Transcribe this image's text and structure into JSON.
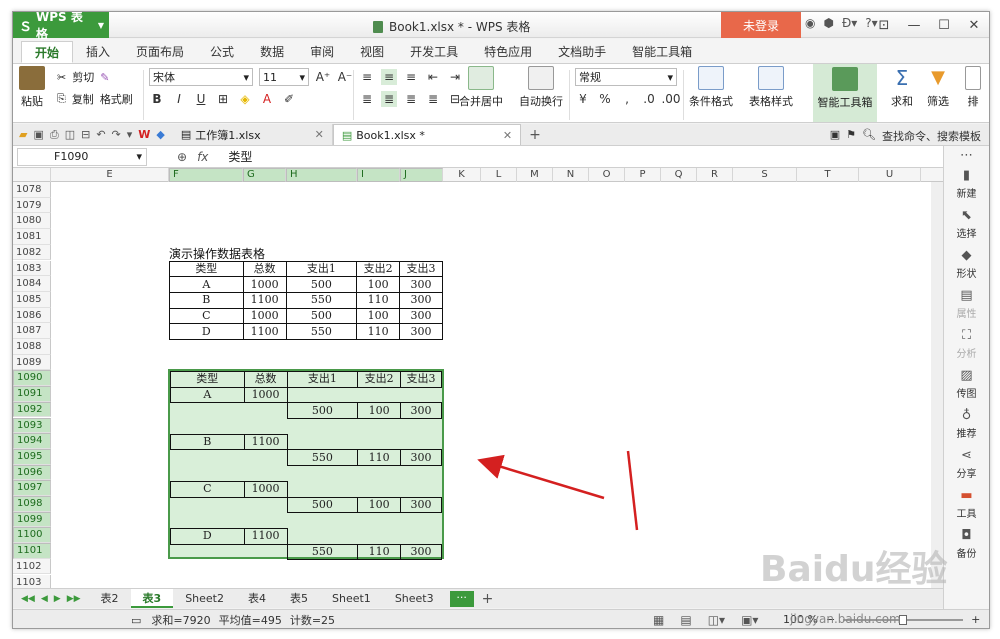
{
  "app": {
    "brand": "WPS 表格",
    "doc_title": "Book1.xlsx * - WPS 表格",
    "login": "未登录"
  },
  "menu": [
    "开始",
    "插入",
    "页面布局",
    "公式",
    "数据",
    "审阅",
    "视图",
    "开发工具",
    "特色应用",
    "文档助手",
    "智能工具箱"
  ],
  "ribbon": {
    "paste": "粘贴",
    "cut": "剪切",
    "copy": "复制",
    "format_painter": "格式刷",
    "font_name": "宋体",
    "font_size": "11",
    "merge_center": "合并居中",
    "wrap": "自动换行",
    "number_format": "常规",
    "cond_format": "条件格式",
    "table_style": "表格样式",
    "smart_toolbox": "智能工具箱",
    "sum": "求和",
    "filter": "筛选",
    "sort": "排"
  },
  "doctabs": {
    "tab1": "工作簿1.xlsx",
    "tab2": "Book1.xlsx *",
    "find": "查找命令、搜索模板"
  },
  "formula": {
    "namebox": "F1090",
    "content": "类型"
  },
  "columns": [
    "E",
    "F",
    "G",
    "H",
    "I",
    "J",
    "K",
    "L",
    "M",
    "N",
    "O",
    "P",
    "Q",
    "R",
    "S",
    "T",
    "U"
  ],
  "rows": [
    "1078",
    "1079",
    "1080",
    "1081",
    "1082",
    "1083",
    "1084",
    "1085",
    "1086",
    "1087",
    "1088",
    "1089",
    "1090",
    "1091",
    "1092",
    "1093",
    "1094",
    "1095",
    "1096",
    "1097",
    "1098",
    "1099",
    "1100",
    "1101",
    "1102",
    "1103"
  ],
  "table1": {
    "caption": "演示操作数据表格",
    "header": [
      "类型",
      "总数",
      "支出1",
      "支出2",
      "支出3"
    ],
    "rows": [
      [
        "A",
        "1000",
        "500",
        "100",
        "300"
      ],
      [
        "B",
        "1100",
        "550",
        "110",
        "300"
      ],
      [
        "C",
        "1000",
        "500",
        "100",
        "300"
      ],
      [
        "D",
        "1100",
        "550",
        "110",
        "300"
      ]
    ]
  },
  "table2": {
    "header": [
      "类型",
      "总数",
      "支出1",
      "支出2",
      "支出3"
    ],
    "groups": [
      {
        "type": "A",
        "total": "1000",
        "vals": [
          "500",
          "100",
          "300"
        ]
      },
      {
        "type": "B",
        "total": "1100",
        "vals": [
          "550",
          "110",
          "300"
        ]
      },
      {
        "type": "C",
        "total": "1000",
        "vals": [
          "500",
          "100",
          "300"
        ]
      },
      {
        "type": "D",
        "total": "1100",
        "vals": [
          "550",
          "110",
          "300"
        ]
      }
    ]
  },
  "rpane": [
    "新建",
    "选择",
    "形状",
    "属性",
    "分析",
    "传图",
    "推荐",
    "分享",
    "工具",
    "备份"
  ],
  "sheets": [
    "表2",
    "表3",
    "Sheet2",
    "表4",
    "表5",
    "Sheet1",
    "Sheet3"
  ],
  "active_sheet": "表3",
  "status": {
    "sum": "求和=7920",
    "avg": "平均值=495",
    "count": "计数=25",
    "zoom": "100 %"
  },
  "watermark": "Baidu经验",
  "watermark_url": "jingyan.baidu.com",
  "colors": {
    "accent": "#3c9a3c",
    "login": "#e8684a",
    "selection": "#d9efd9",
    "arrow": "#d42020"
  }
}
